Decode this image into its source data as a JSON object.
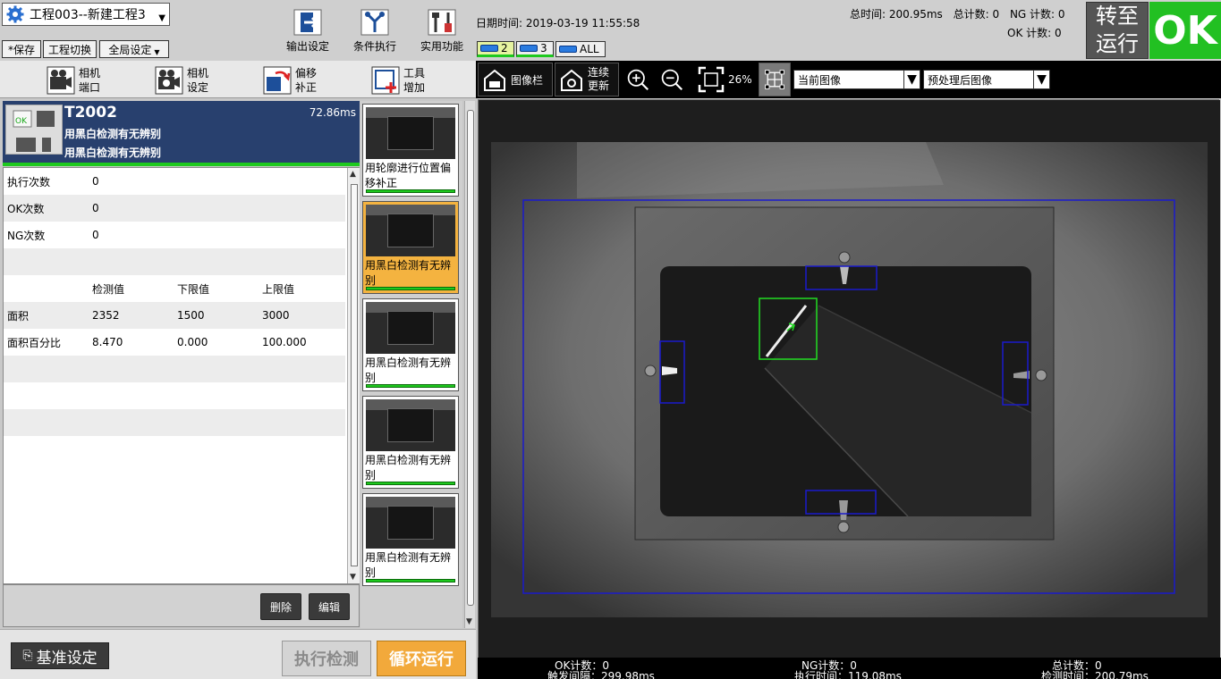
{
  "project": {
    "title": "工程003--新建工程3"
  },
  "top_buttons": {
    "save": "*保存",
    "switch": "工程切换",
    "global": "全局设定"
  },
  "tools": {
    "output": "输出设定",
    "condition": "条件执行",
    "utility": "实用功能"
  },
  "datetime": "日期时间: 2019-03-19 11:55:58",
  "stats": {
    "total_time": "总时间: 200.95ms",
    "total_count": "总计数: 0",
    "ng_count": "NG 计数: 0",
    "ok_count": "OK 计数: 0"
  },
  "run_switch": {
    "line1": "转至",
    "line2": "运行"
  },
  "result_badge": "OK",
  "camera_tabs": [
    {
      "label": "2"
    },
    {
      "label": "3"
    },
    {
      "label": "ALL"
    }
  ],
  "left_toolbar": {
    "camera_port": {
      "l1": "相机",
      "l2": "端口"
    },
    "camera_setting": {
      "l1": "相机",
      "l2": "设定"
    },
    "offset": {
      "l1": "偏移",
      "l2": "补正"
    },
    "tool_add": {
      "l1": "工具",
      "l2": "增加"
    }
  },
  "tool_header": {
    "id": "T2002",
    "time": "72.86ms",
    "desc1": "用黑白检测有无辨别",
    "desc2": "用黑白检测有无辨别",
    "badge": "OK"
  },
  "details": {
    "rows": [
      {
        "c0": "执行次数",
        "c1": "0",
        "c2": "",
        "c3": ""
      },
      {
        "c0": "OK次数",
        "c1": "0",
        "c2": "",
        "c3": ""
      },
      {
        "c0": "NG次数",
        "c1": "0",
        "c2": "",
        "c3": ""
      },
      {
        "c0": "",
        "c1": "",
        "c2": "",
        "c3": ""
      },
      {
        "c0": "",
        "c1": "检测值",
        "c2": "下限值",
        "c3": "上限值"
      },
      {
        "c0": "面积",
        "c1": "2352",
        "c2": "1500",
        "c3": "3000"
      },
      {
        "c0": "面积百分比",
        "c1": "8.470",
        "c2": "0.000",
        "c3": "100.000"
      },
      {
        "c0": "",
        "c1": "",
        "c2": "",
        "c3": ""
      },
      {
        "c0": "",
        "c1": "",
        "c2": "",
        "c3": ""
      },
      {
        "c0": "",
        "c1": "",
        "c2": "",
        "c3": ""
      }
    ],
    "delete": "删除",
    "edit": "编辑"
  },
  "thumbnails": [
    {
      "label": "用轮廓进行位置偏移补正",
      "active": false
    },
    {
      "label": "用黑白检测有无辨别",
      "active": true
    },
    {
      "label": "用黑白检测有无辨别",
      "active": false
    },
    {
      "label": "用黑白检测有无辨别",
      "active": false
    },
    {
      "label": "用黑白检测有无辨别",
      "active": false
    }
  ],
  "bottom_left": {
    "base": "基准设定",
    "exec": "执行检测",
    "loop": "循环运行"
  },
  "image_toolbar": {
    "image_bar": "图像栏",
    "continuous_l1": "连续",
    "continuous_l2": "更新",
    "zoom": "26%",
    "current_image": "当前图像",
    "processed_image": "预处理后图像"
  },
  "viewer_status": {
    "ok": "OK计数：0",
    "trigger": "触发间隔：299.98ms",
    "ng": "NG计数：0",
    "exec_time": "执行时间：119.08ms",
    "total": "总计数：0",
    "detect_time": "检测时间：200.79ms"
  },
  "colors": {
    "ok_green": "#22c022",
    "header_navy": "#28406e",
    "roi_blue": "#1a1acc",
    "detect_green": "#22dd22",
    "active_orange": "#f4b340"
  }
}
